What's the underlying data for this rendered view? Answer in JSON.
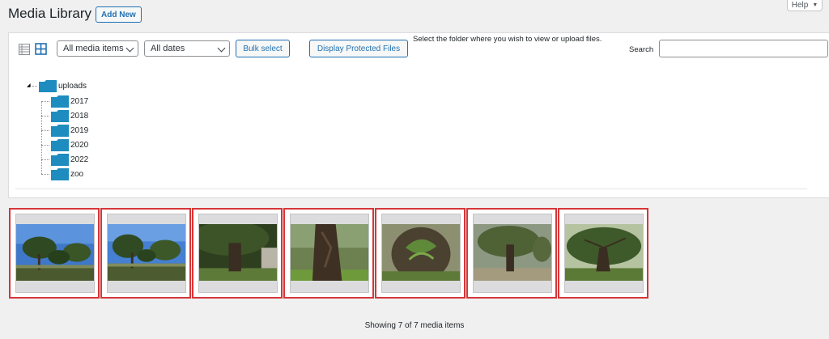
{
  "help_tab": {
    "label": "Help",
    "icon": "caret-down-icon"
  },
  "header": {
    "title": "Media Library",
    "add_new_label": "Add New"
  },
  "toolbar": {
    "view_list_icon": "list-view-icon",
    "view_grid_icon": "grid-view-icon",
    "media_type_filter": {
      "selected": "All media items"
    },
    "date_filter": {
      "selected": "All dates"
    },
    "bulk_select_label": "Bulk select",
    "protected_files_label": "Display Protected Files",
    "folder_hint": "Select the folder where you wish to view or upload files.",
    "search_label": "Search",
    "search_value": ""
  },
  "folder_tree": {
    "root": {
      "label": "uploads",
      "icon": "folder-icon"
    },
    "children": [
      {
        "label": "2017"
      },
      {
        "label": "2018"
      },
      {
        "label": "2019"
      },
      {
        "label": "2020"
      },
      {
        "label": "2022"
      },
      {
        "label": "zoo"
      }
    ],
    "folder_color": "#1e8cbe"
  },
  "gallery": {
    "items": [
      {
        "alt": "park with large trees and blue sky"
      },
      {
        "alt": "park with large trees and blue sky"
      },
      {
        "alt": "large tree trunk in park"
      },
      {
        "alt": "twisted tree trunk close-up"
      },
      {
        "alt": "tree trunk with ferns"
      },
      {
        "alt": "tree in park path"
      },
      {
        "alt": "wide tree canopy"
      }
    ],
    "selected_border_color": "#d63638"
  },
  "footer": {
    "showing_text": "Showing 7 of 7 media items"
  },
  "colors": {
    "accent": "#2271b1",
    "background": "#f0f0f1"
  }
}
